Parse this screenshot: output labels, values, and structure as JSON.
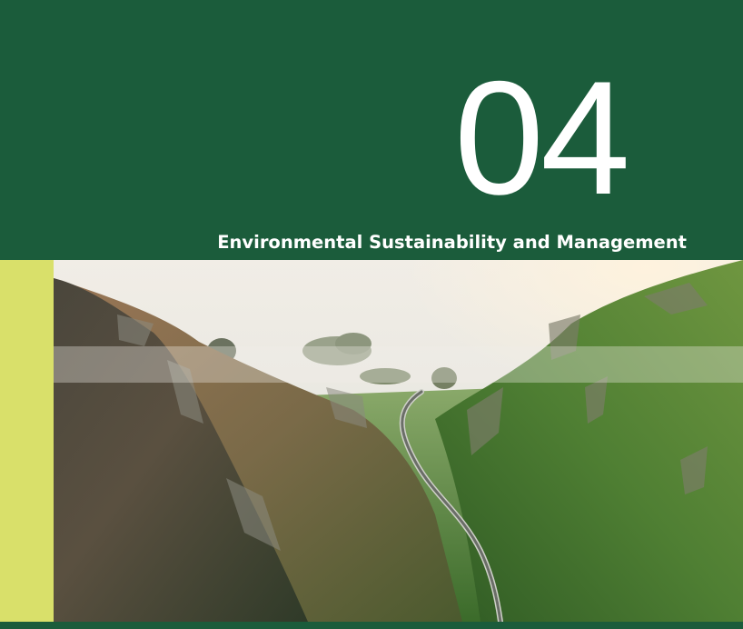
{
  "section": {
    "number": "04",
    "title": "Environmental Sustainability and Management"
  },
  "colors": {
    "brand_green": "#1b5c3b",
    "accent_lime": "#d9e06a",
    "text": "#ffffff"
  },
  "photo": {
    "subject": "valley-road-landscape"
  }
}
